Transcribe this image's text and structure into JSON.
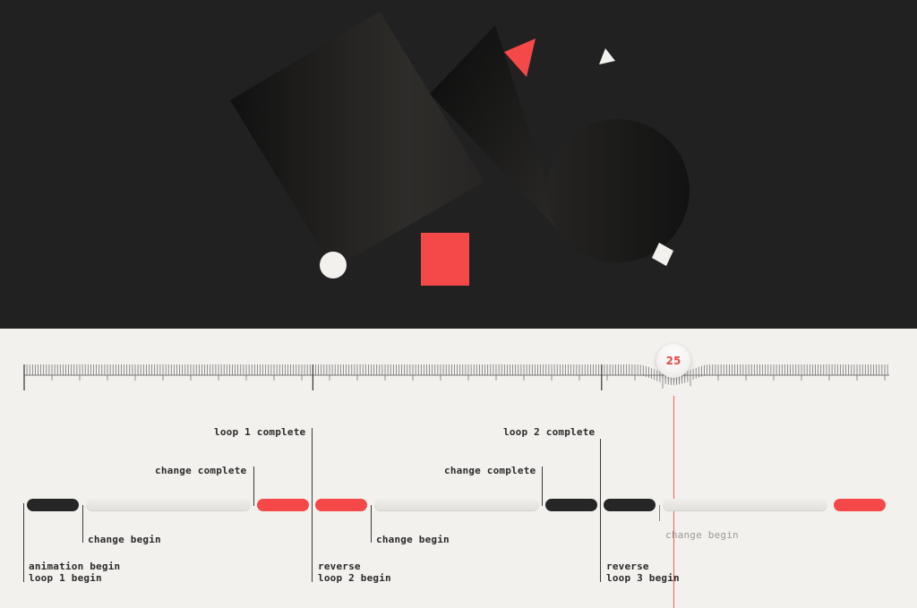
{
  "colors": {
    "stage_bg": "#222122",
    "timeline_bg": "#f3f1ee",
    "accent_red": "#f54848",
    "dark_segment": "#262626",
    "light_segment": "#e6e4e1",
    "playhead": "#f25c5c"
  },
  "playhead": {
    "value": "25"
  },
  "segments": [
    {
      "type": "dark"
    },
    {
      "type": "light"
    },
    {
      "type": "red"
    },
    {
      "type": "red"
    },
    {
      "type": "light"
    },
    {
      "type": "dark"
    },
    {
      "type": "dark"
    },
    {
      "type": "light"
    },
    {
      "type": "red"
    }
  ],
  "markers": {
    "loop1_complete": "loop 1 complete",
    "loop2_complete": "loop 2 complete",
    "change_complete_1": "change complete",
    "change_complete_2": "change complete",
    "change_begin_1": "change begin",
    "change_begin_2": "change begin",
    "change_begin_3": "change begin",
    "animation_begin": "animation begin\nloop 1 begin",
    "reverse_loop2": "reverse\nloop 2 begin",
    "reverse_loop3": "reverse\nloop 3 begin"
  }
}
